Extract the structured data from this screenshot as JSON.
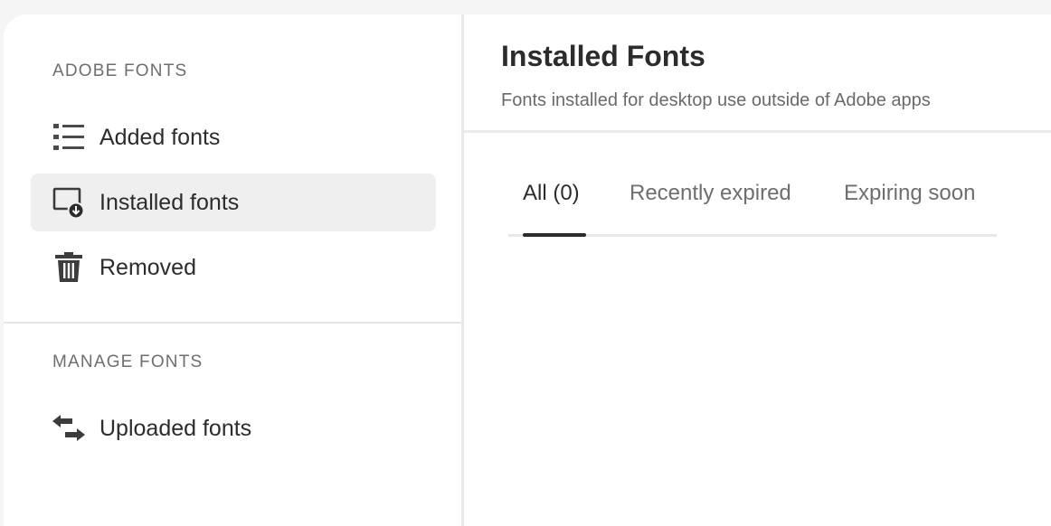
{
  "sidebar": {
    "adobe_fonts_heading": "ADOBE FONTS",
    "manage_fonts_heading": "MANAGE FONTS",
    "items": [
      {
        "label": "Added fonts",
        "icon": "list-icon"
      },
      {
        "label": "Installed fonts",
        "icon": "install-desktop-icon",
        "selected": true
      },
      {
        "label": "Removed",
        "icon": "trash-icon"
      },
      {
        "label": "Uploaded fonts",
        "icon": "transfer-arrows-icon"
      }
    ]
  },
  "main": {
    "title": "Installed Fonts",
    "subtitle": "Fonts installed for desktop use outside of Adobe apps",
    "tabs": [
      {
        "label": "All (0)",
        "active": true
      },
      {
        "label": "Recently expired"
      },
      {
        "label": "Expiring soon"
      }
    ]
  },
  "colors": {
    "text_primary": "#2c2c2c",
    "text_secondary": "#6e6e6e",
    "selected_bg": "#efefef",
    "divider": "#e8e8e8",
    "background": "#f5f5f5"
  }
}
